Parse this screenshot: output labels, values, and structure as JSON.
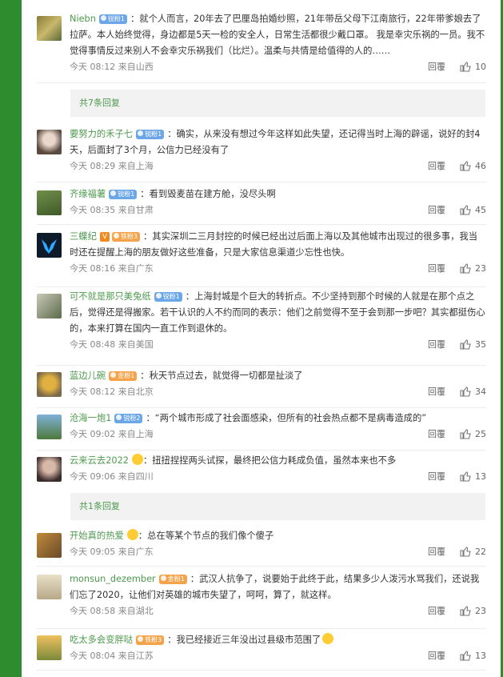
{
  "colors": {
    "accent_green": "#2e8b2e",
    "name_green": "#4e9a4e",
    "meta_gray": "#888888"
  },
  "comments": [
    {
      "user": "Niebn",
      "badge": "锐粉1",
      "badge_color": "blue",
      "text": "：就个人而言，20年去了巴厘岛拍婚纱照，21年带岳父母下江南旅行，22年带爹娘去了拉萨。本人始终觉得，身边都是5天一检的安全人，日常生活都很少戴口罩。 我是幸灾乐祸的一员。我不觉得事情反过来别人不会幸灾乐祸我们（比烂）。温柔与共情是给值得的人的……",
      "time": "今天 08:12",
      "location": "来自山西",
      "reply": "回覆",
      "likes": "10"
    },
    {
      "user": "要努力的禾子七",
      "badge": "锐粉1",
      "badge_color": "blue",
      "text": "：确实，从来没有想过今年这样如此失望，还记得当时上海的辟谣，说好的封4天，后面封了3个月，公信力已经没有了",
      "time": "今天 08:29",
      "location": "来自上海",
      "reply": "回覆",
      "likes": "46"
    },
    {
      "user": "齐缘福薯",
      "badge": "锐粉1",
      "badge_color": "blue",
      "text": "：看到毁麦苗在建方舱，没尽头啊",
      "time": "今天 08:35",
      "location": "来自甘肃",
      "reply": "回覆",
      "likes": "45"
    },
    {
      "user": "三蝶纪",
      "vip": "V",
      "badge": "铁粉3",
      "badge_color": "orange",
      "text": "：其实深圳二三月封控的时候已经出过后面上海以及其他城市出现过的很多事，我当时还在提醒上海的朋友做好这些准备，只是大家信息渠道少忘性也快。",
      "time": "今天 08:16",
      "location": "来自广东",
      "reply": "回覆",
      "likes": "23"
    },
    {
      "user": "可不就是那只美兔纸",
      "badge": "锐粉1",
      "badge_color": "blue",
      "text": "：上海封城是个巨大的转折点。不少坚持到那个时候的人就是在那个点之后，觉得还是得搬家。若干认识的人不约而同的表示：他们之前觉得不至于会到那一步吧？其实都挺伤心的，本来打算在国内一直工作到退休的。",
      "time": "今天 08:48",
      "location": "来自美国",
      "reply": "回覆",
      "likes": "35"
    },
    {
      "user": "蓝边儿碗",
      "badge": "金粉1",
      "badge_color": "orange",
      "text": "：秋天节点过去，就觉得一切都是扯淡了",
      "time": "今天 08:12",
      "location": "来自北京",
      "reply": "回覆",
      "likes": "34"
    },
    {
      "user": "沧海一炮1",
      "badge": "锐粉2",
      "badge_color": "blue",
      "text": "：“两个城市形成了社会面感染，但所有的社会热点都不是病毒造成的”",
      "time": "今天 09:02",
      "location": "来自上海",
      "reply": "回覆",
      "likes": "25"
    },
    {
      "user": "云来云去2022",
      "emoji_badge": true,
      "text": "：扭扭捏捏两头试探，最终把公信力耗成负值，虽然本来也不多",
      "time": "今天 09:06",
      "location": "来自四川",
      "reply": "回覆",
      "likes": "13"
    },
    {
      "user": "开始真的热爱",
      "emoji_badge": true,
      "text": "：总在等某个节点的我们像个傻子",
      "time": "今天 09:05",
      "location": "来自广东",
      "reply": "回覆",
      "likes": "22"
    },
    {
      "user": "monsun_dezember",
      "badge": "金粉1",
      "badge_color": "orange",
      "text": "：武汉人抗争了，说要始于此终于此，结果多少人泼污水骂我们，还说我们忘了2020，让他们对英雄的城市失望了，呵呵，算了，就这样。",
      "time": "今天 08:58",
      "location": "来自湖北",
      "reply": "回覆",
      "likes": "23"
    },
    {
      "user": "吃太多会变胖哒",
      "badge": "铁粉3",
      "badge_color": "orange",
      "text": "：我已经接近三年没出过县级市范围了",
      "time": "今天 08:04",
      "location": "来自江苏",
      "reply": "回覆",
      "likes": "13"
    }
  ],
  "more_replies": [
    "共7条回复",
    "共1条回复"
  ]
}
